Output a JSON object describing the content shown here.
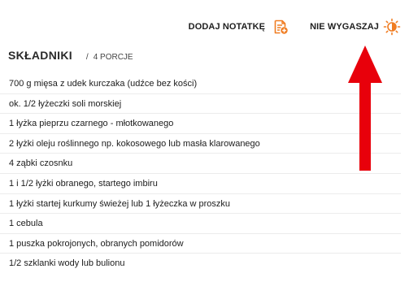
{
  "toolbar": {
    "add_note_label": "DODAJ NOTATKĘ",
    "wake_lock_label": "NIE WYGASZAJ",
    "icons": {
      "note": "note-add-icon",
      "wake": "half-sun-icon"
    },
    "accent_color": "#f07d22"
  },
  "ingredients": {
    "title": "SKŁADNIKI",
    "separator": "/",
    "portions": "4 PORCJE",
    "items": [
      "700 g mięsa z udek kurczaka (udźce bez kości)",
      "ok. 1/2 łyżeczki soli morskiej",
      "1 łyżka pieprzu czarnego - młotkowanego",
      "2 łyżki oleju roślinnego np. kokosowego lub masła klarowanego",
      "4 ząbki czosnku",
      "1 i 1/2 łyżki obranego, startego imbiru",
      "1 łyżki startej kurkumy świeżej lub 1 łyżeczka w proszku",
      "1 cebula",
      "1 puszka pokrojonych, obranych pomidorów",
      "1/2 szklanki wody lub bulionu"
    ]
  },
  "annotation": {
    "arrow_color": "#e8000b",
    "arrow_direction": "up"
  }
}
